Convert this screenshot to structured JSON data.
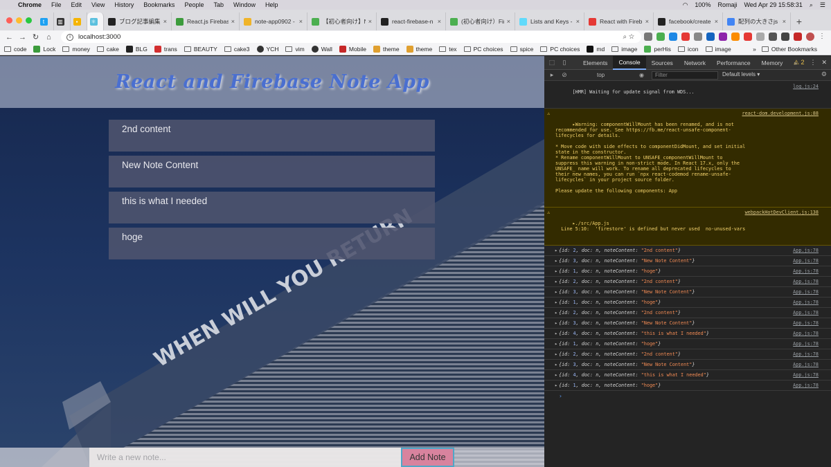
{
  "menubar": {
    "app": "Chrome",
    "items": [
      "File",
      "Edit",
      "View",
      "History",
      "Bookmarks",
      "People",
      "Tab",
      "Window",
      "Help"
    ],
    "battery": "100%",
    "input_method": "Romaji",
    "clock": "Wed Apr 29  15:58:31"
  },
  "tabs": [
    {
      "label": "ブログ記事編集 - ",
      "icon_color": "#f5a623"
    },
    {
      "label": "React.js Firebase",
      "icon_color": "#3c9b3c"
    },
    {
      "label": "note-app0902 - ",
      "icon_color": "#f0b429"
    },
    {
      "label": "【初心者向け】NP",
      "icon_color": "#4caf50"
    },
    {
      "label": "react-firebase-n",
      "icon_color": "#222222"
    },
    {
      "label": "(初心者向け）Fir",
      "icon_color": "#4caf50"
    },
    {
      "label": "Lists and Keys -",
      "icon_color": "#61dafb"
    },
    {
      "label": "React with Fireb",
      "icon_color": "#e53935"
    },
    {
      "label": "facebook/create",
      "icon_color": "#222222"
    },
    {
      "label": "配列の大きさjs - G",
      "icon_color": "#4285f4"
    }
  ],
  "address": {
    "url": "localhost:3000"
  },
  "bookmarks": [
    "code",
    "Lock",
    "money",
    "cake",
    "BLG",
    "trans",
    "BEAUTY",
    "cake3",
    "YCH",
    "vim",
    "Wall",
    "Mobile",
    "theme",
    "theme",
    "tex",
    "PC choices",
    "spice",
    "PC choices",
    "md",
    "image",
    "perHis",
    "icon",
    "image"
  ],
  "other_bookmarks": "Other Bookmarks",
  "app": {
    "title": "React and Firebase Note App",
    "notes": [
      "2nd content",
      "New Note Content",
      "this is what I needed",
      "hoge"
    ],
    "input_placeholder": "Write a new note...",
    "add_button": "Add Note",
    "background_sign": "WHEN WILL YOU RETURN"
  },
  "devtools": {
    "tabs": [
      "Elements",
      "Console",
      "Sources",
      "Network",
      "Performance",
      "Memory"
    ],
    "active_tab": "Console",
    "warning_count": "2",
    "context": "top",
    "filter_placeholder": "Filter",
    "levels": "Default levels",
    "hmr": {
      "text": "[HMR] Waiting for update signal from WDS...",
      "src": "log.js:24"
    },
    "warning1": {
      "text": "▸Warning: componentWillMount has been renamed, and is not\nrecommended for use. See https://fb.me/react-unsafe-component-lifecycles for details.\n\n* Move code with side effects to componentDidMount, and set initial state in the constructor.\n* Rename componentWillMount to UNSAFE_componentWillMount to suppress this warning in non-strict mode. In React 17.x, only the UNSAFE_ name will work. To rename all deprecated lifecycles to their new names, you can run `npx react-codemod rename-unsafe-lifecycles` in your project source folder.\n\nPlease update the following components: App",
      "src": "react-dom.development.js:88"
    },
    "warning2": {
      "text": "▸./src/App.js\n  Line 5:10:  'firestore' is defined but never used  no-unused-vars",
      "src": "webpackHotDevClient.js:138"
    },
    "logs": [
      {
        "id": "2",
        "content": "2nd content"
      },
      {
        "id": "3",
        "content": "New Note Content"
      },
      {
        "id": "1",
        "content": "hoge"
      },
      {
        "id": "2",
        "content": "2nd content"
      },
      {
        "id": "3",
        "content": "New Note Content"
      },
      {
        "id": "1",
        "content": "hoge"
      },
      {
        "id": "2",
        "content": "2nd content"
      },
      {
        "id": "3",
        "content": "New Note Content"
      },
      {
        "id": "4",
        "content": "this is what I needed"
      },
      {
        "id": "1",
        "content": "hoge"
      },
      {
        "id": "2",
        "content": "2nd content"
      },
      {
        "id": "3",
        "content": "New Note Content"
      },
      {
        "id": "4",
        "content": "this is what I needed"
      },
      {
        "id": "1",
        "content": "hoge"
      }
    ],
    "log_src": "App.js:78"
  }
}
